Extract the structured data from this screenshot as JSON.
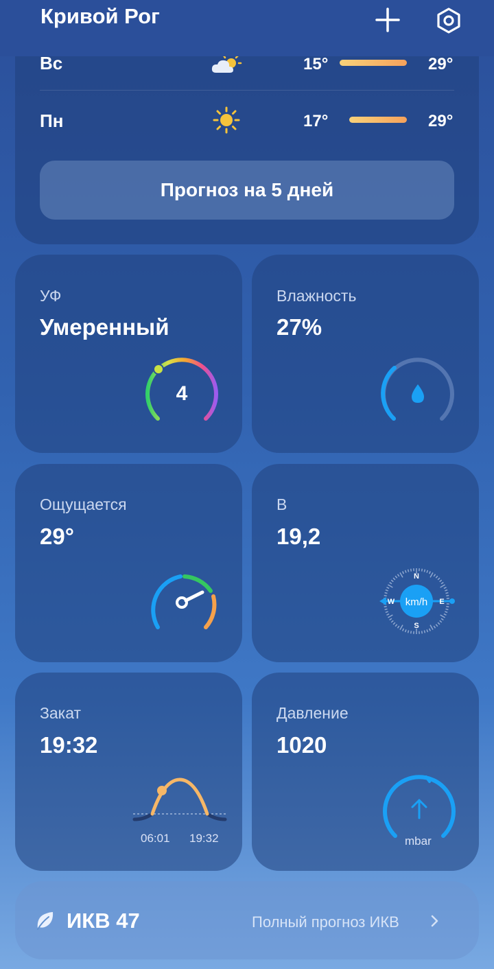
{
  "header": {
    "city": "Кривой Рог",
    "add_icon": "plus-icon",
    "settings_icon": "settings-hex-icon"
  },
  "forecast": {
    "days": [
      {
        "label": "Вс",
        "icon": "partly-cloudy-icon",
        "min": "15°",
        "max": "29°"
      },
      {
        "label": "Пн",
        "icon": "sun-icon",
        "min": "17°",
        "max": "29°"
      }
    ],
    "five_day_button": "Прогноз на 5 дней"
  },
  "tiles": {
    "uv": {
      "label": "УФ",
      "value": "Умеренный",
      "index": "4"
    },
    "humidity": {
      "label": "Влажность",
      "value": "27%",
      "level": 0.27
    },
    "feels_like": {
      "label": "Ощущается",
      "value": "29°"
    },
    "wind": {
      "label": "В",
      "value": "19,2",
      "unit": "km/h",
      "compass": {
        "n": "N",
        "e": "E",
        "s": "S",
        "w": "W"
      }
    },
    "sunset": {
      "label": "Закат",
      "value": "19:32",
      "sunrise_time": "06:01",
      "sunset_time": "19:32"
    },
    "pressure": {
      "label": "Давление",
      "value": "1020",
      "unit": "mbar"
    }
  },
  "aqi": {
    "icon": "leaf-icon",
    "label": "ИКВ 47",
    "link": "Полный прогноз ИКВ"
  },
  "colors": {
    "bar_warm": "#f6c66e",
    "bar_hot": "#f5a35e",
    "accent_blue": "#1aa0f5"
  }
}
